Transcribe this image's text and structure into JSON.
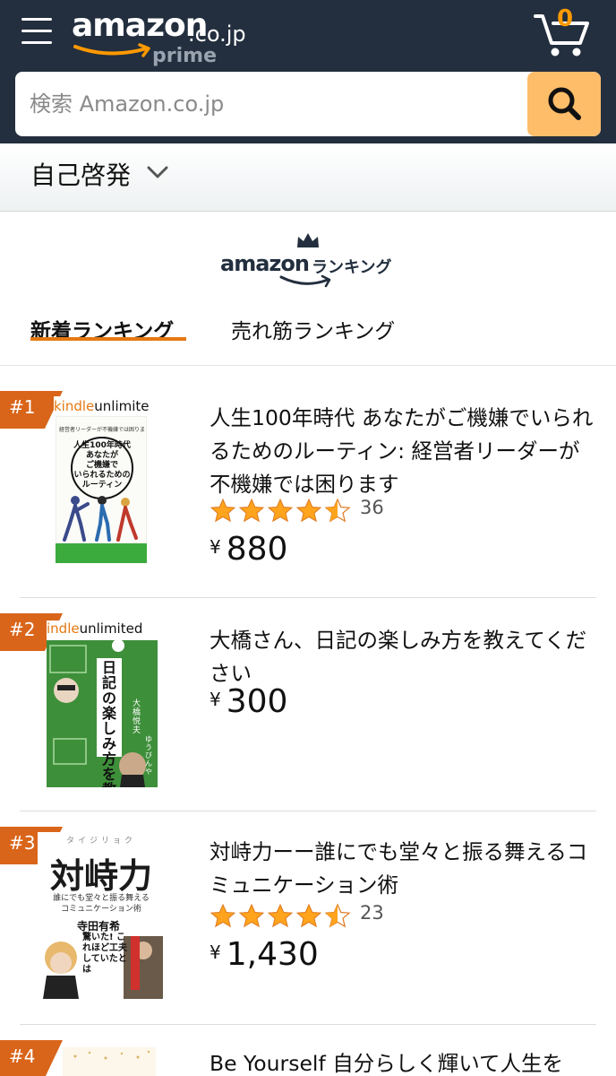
{
  "header": {
    "logo_text": "amazon",
    "logo_tld": ".co.jp",
    "logo_sub": "prime",
    "cart_count": "0",
    "search_placeholder": "検索 Amazon.co.jp"
  },
  "category": {
    "label": "自己啓発"
  },
  "ranking_logo": {
    "brand": "amazon",
    "label": "ランキング"
  },
  "tabs": [
    {
      "label": "新着ランキング",
      "active": true
    },
    {
      "label": "売れ筋ランキング",
      "active": false
    }
  ],
  "items": [
    {
      "rank": "#1",
      "title": "人生100年時代 あなたがご機嫌でいられるためのルーティン: 経営者リーダーが不機嫌では困ります",
      "rating": 4.5,
      "rating_count": "36",
      "currency": "¥",
      "price": "880",
      "cover": {
        "ku_a": "kindle",
        "ku_b": "unlimited",
        "small_top": "経営者リーダーが不機嫌では困ります",
        "lines": [
          "人生100年時代",
          "あなたが",
          "ご機嫌で",
          "いられるための",
          "ルーティン"
        ]
      }
    },
    {
      "rank": "#2",
      "title": "大橋さん、日記の楽しみ方を教えてください",
      "currency": "¥",
      "price": "300",
      "cover": {
        "ku_a": "indle",
        "ku_b": "unlimited",
        "main": "日記の楽しみ方を教えてください",
        "name_a": "大橋悦夫",
        "name_b": "ゆうびんや"
      }
    },
    {
      "rank": "#3",
      "title": "対峙力ーー誰にでも堂々と振る舞えるコミュニケーション術",
      "rating": 4.5,
      "rating_count": "23",
      "currency": "¥",
      "price": "1,430",
      "cover": {
        "kana": "タイジリョク",
        "main": "対峙力",
        "sub_a": "誰にでも堂々と振る舞える",
        "sub_b": "コミュニケーション術",
        "author": "寺田有希",
        "tagline": "驚いた! これほど工夫していたとは"
      }
    },
    {
      "rank": "#4",
      "title": "Be Yourself 自分らしく輝いて人生を"
    }
  ],
  "colors": {
    "header_bg": "#232f3e",
    "search_button": "#febd69",
    "accent_orange": "#e47911",
    "rank_badge": "#d9651a",
    "star": "#ffa41c"
  }
}
